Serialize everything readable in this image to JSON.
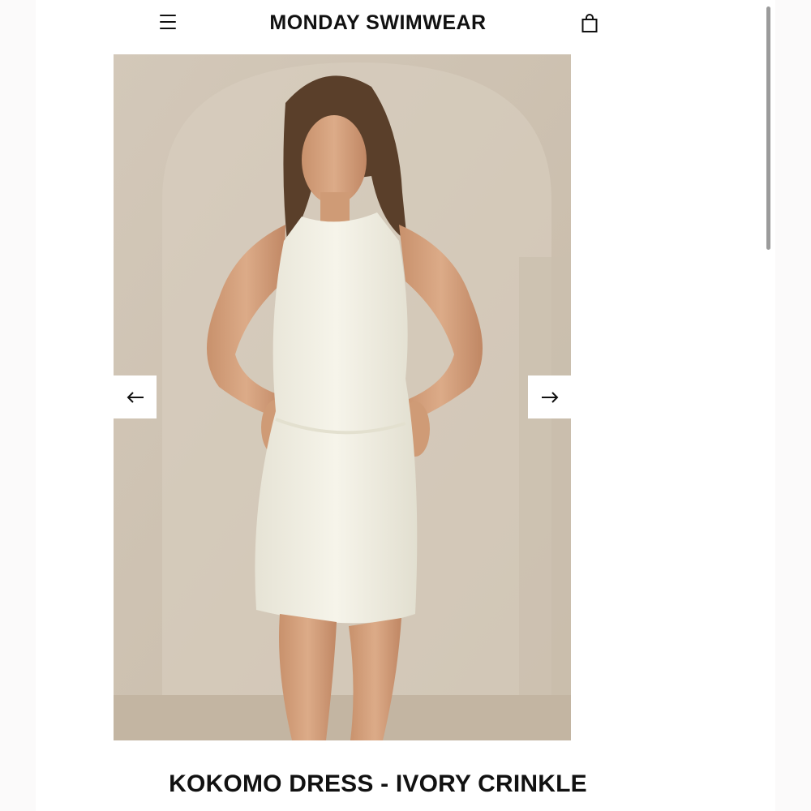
{
  "header": {
    "brand": "MONDAY SWIMWEAR",
    "menu_icon": "hamburger-menu-icon",
    "cart_icon": "shopping-bag-icon"
  },
  "gallery": {
    "image_description": "Model wearing an ivory crinkle sleeveless mini dress, hands on hips, beige arched background",
    "prev_icon": "arrow-left-icon",
    "next_icon": "arrow-right-icon"
  },
  "product": {
    "title": "KOKOMO DRESS - IVORY CRINKLE"
  },
  "colors": {
    "background": "#ffffff",
    "text": "#111111",
    "photo_backdrop": "#cfc3b3"
  }
}
